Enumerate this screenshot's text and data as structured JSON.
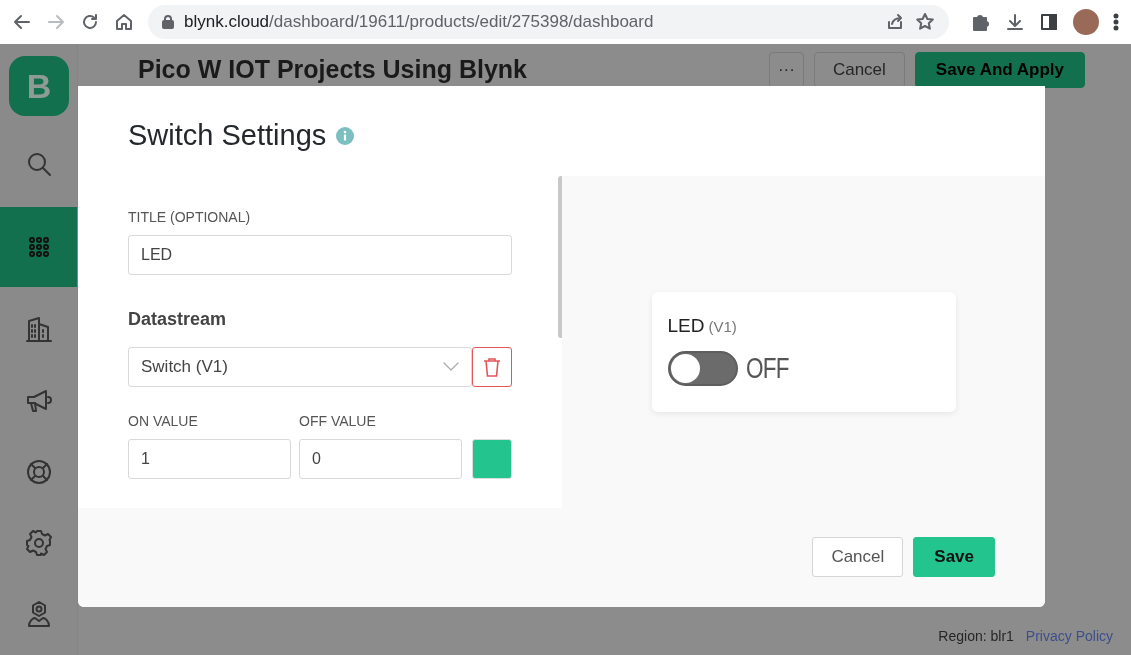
{
  "browser": {
    "url_host": "blynk.cloud",
    "url_path": "/dashboard/19611/products/edit/275398/dashboard",
    "forward_disabled": true
  },
  "sidebar": {
    "logo_text": "B",
    "items": [
      {
        "kind": "search",
        "selected": false
      },
      {
        "kind": "grid",
        "selected": true
      },
      {
        "kind": "building",
        "selected": false
      },
      {
        "kind": "megaphone",
        "selected": false
      },
      {
        "kind": "lifebuoy",
        "selected": false
      },
      {
        "kind": "gear",
        "selected": false
      },
      {
        "kind": "user",
        "selected": false
      }
    ]
  },
  "page": {
    "title": "Pico W IOT Projects Using Blynk",
    "buttons": [
      {
        "kind": "more",
        "label": "···"
      },
      {
        "kind": "secondary",
        "label": "Cancel"
      },
      {
        "kind": "primary",
        "label": "Save And Apply"
      }
    ]
  },
  "dialog": {
    "title": "Switch Settings",
    "title_field": {
      "label": "TITLE (OPTIONAL)",
      "value": "LED"
    },
    "datastream": {
      "heading": "Datastream",
      "value": "Switch (V1)",
      "on_label": "ON VALUE",
      "on_value": "1",
      "off_label": "OFF VALUE",
      "off_value": "0",
      "color": "#23c48e"
    },
    "preview": {
      "label": "LED",
      "pin": "(V1)",
      "on": false,
      "state_text": "OFF"
    },
    "buttons": [
      {
        "kind": "secondary",
        "label": "Cancel"
      },
      {
        "kind": "primary",
        "label": "Save"
      }
    ]
  },
  "footer": {
    "region": "Region: blr1",
    "link": "Privacy Policy"
  }
}
